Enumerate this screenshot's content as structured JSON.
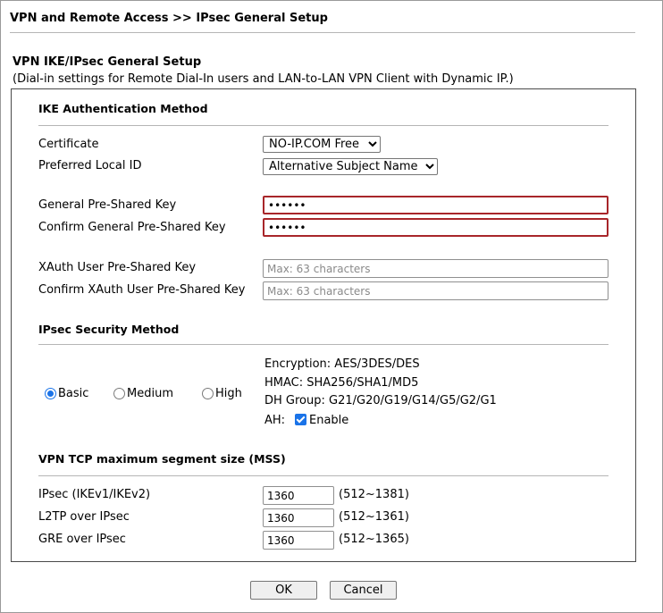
{
  "header": {
    "title": "VPN and Remote Access >> IPsec General Setup"
  },
  "section": {
    "title": "VPN IKE/IPsec General Setup",
    "subtitle": "(Dial-in settings for Remote Dial-In users and LAN-to-LAN VPN Client with Dynamic IP.)"
  },
  "ike": {
    "heading": "IKE Authentication Method",
    "certificate_label": "Certificate",
    "certificate_value": "NO-IP.COM Free",
    "preferred_local_id_label": "Preferred Local ID",
    "preferred_local_id_value": "Alternative Subject Name",
    "general_psk_label": "General Pre-Shared Key",
    "general_psk_value": "••••••",
    "confirm_general_psk_label": "Confirm General Pre-Shared Key",
    "confirm_general_psk_value": "••••••",
    "xauth_psk_label": "XAuth User Pre-Shared Key",
    "xauth_psk_placeholder": "Max: 63 characters",
    "confirm_xauth_psk_label": "Confirm XAuth User Pre-Shared Key",
    "confirm_xauth_psk_placeholder": "Max: 63 characters"
  },
  "ipsec_security": {
    "heading": "IPsec Security Method",
    "options": [
      {
        "label": "Basic",
        "selected": true
      },
      {
        "label": "Medium",
        "selected": false
      },
      {
        "label": "High",
        "selected": false
      }
    ],
    "encryption": "Encryption: AES/3DES/DES",
    "hmac": "HMAC: SHA256/SHA1/MD5",
    "dh_group": "DH Group: G21/G20/G19/G14/G5/G2/G1",
    "ah_label": "AH:",
    "ah_enable_label": "Enable",
    "ah_enabled": true
  },
  "mss": {
    "heading": "VPN TCP maximum segment size (MSS)",
    "rows": [
      {
        "label": "IPsec (IKEv1/IKEv2)",
        "value": "1360",
        "range": "(512~1381)"
      },
      {
        "label": "L2TP over IPsec",
        "value": "1360",
        "range": "(512~1361)"
      },
      {
        "label": "GRE over IPsec",
        "value": "1360",
        "range": "(512~1365)"
      }
    ]
  },
  "buttons": {
    "ok": "OK",
    "cancel": "Cancel"
  },
  "colors": {
    "error_border": "#a8262a",
    "accent": "#1a73e8"
  }
}
